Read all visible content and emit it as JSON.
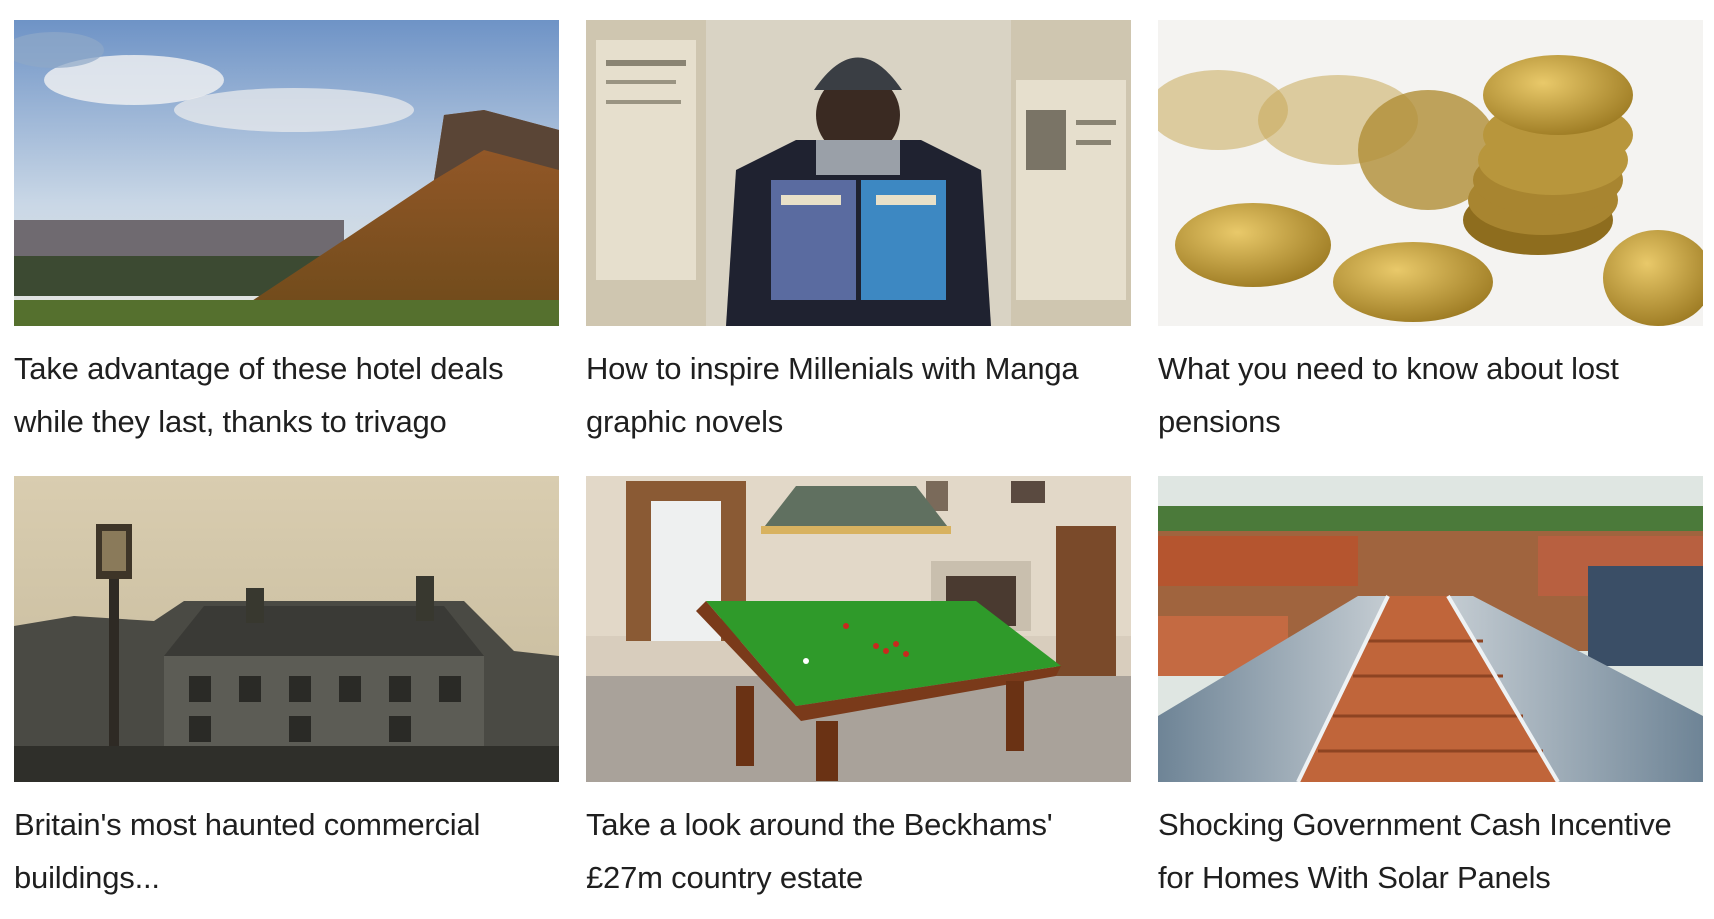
{
  "widget": {
    "cards": [
      {
        "title": "Take advantage of these hotel deals while they last, thanks to trivago",
        "image_icon": "hillside-city-photo"
      },
      {
        "title": "How to inspire Millenials with Manga graphic novels",
        "image_icon": "man-reading-comic-photo"
      },
      {
        "title": "What you need to know about lost pensions",
        "image_icon": "pound-coins-photo"
      },
      {
        "title": "Britain's most haunted commercial buildings...",
        "image_icon": "old-inn-photo"
      },
      {
        "title": "Take a look around the Beckhams' £27m country estate",
        "image_icon": "snooker-room-photo"
      },
      {
        "title": "Shocking Government Cash Incentive for Homes With Solar Panels",
        "image_icon": "solar-panels-roof-photo"
      }
    ]
  },
  "colors": {
    "caption_text": "#1f1f1f",
    "background": "#ffffff"
  }
}
